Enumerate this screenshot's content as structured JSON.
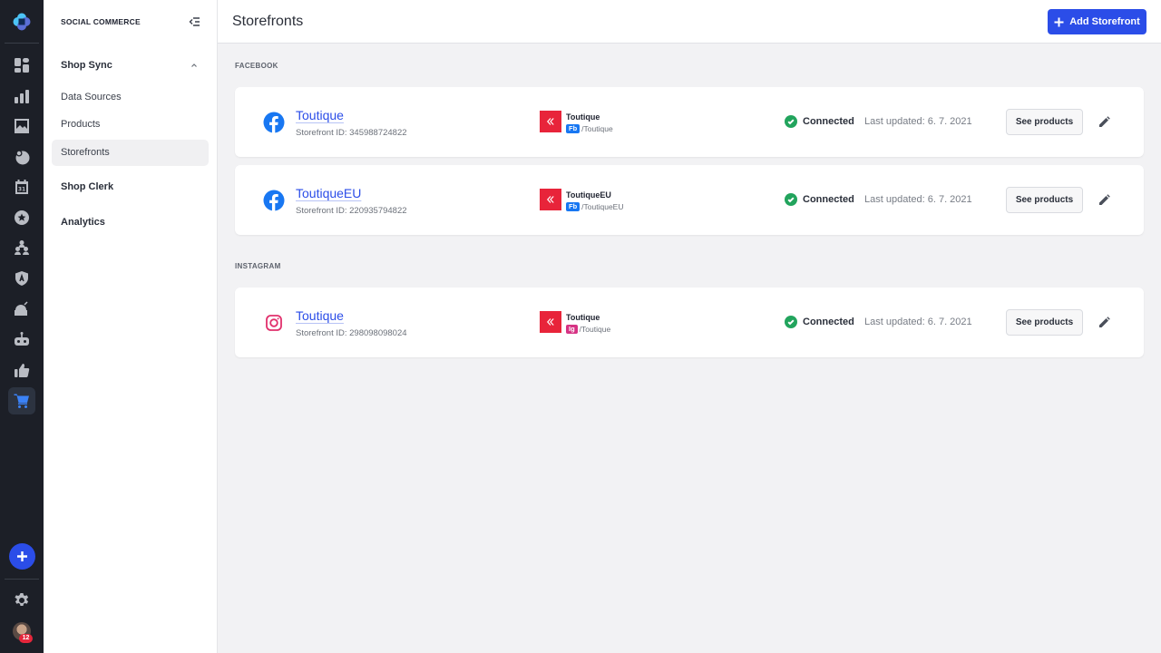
{
  "app": {
    "colors": {
      "accent": "#2b4de8",
      "success": "#22a45d",
      "rail_bg": "#1c1f27",
      "shop_logo": "#e8243a",
      "facebook": "#1877f2",
      "instagram": "#e1306c"
    }
  },
  "rail": {
    "items": [
      {
        "icon": "dashboard-icon"
      },
      {
        "icon": "bar-chart-icon"
      },
      {
        "icon": "image-icon"
      },
      {
        "icon": "audience-icon"
      },
      {
        "icon": "calendar-icon",
        "label": "31"
      },
      {
        "icon": "star-badge-icon"
      },
      {
        "icon": "hierarchy-icon"
      },
      {
        "icon": "shield-icon"
      },
      {
        "icon": "bomb-icon"
      },
      {
        "icon": "robot-icon"
      },
      {
        "icon": "thumbs-up-icon"
      },
      {
        "icon": "shopping-cart-icon",
        "active": true
      }
    ],
    "notifications_count": "12"
  },
  "nav": {
    "title": "SOCIAL COMMERCE",
    "groups": [
      {
        "label": "Shop Sync",
        "expanded": true,
        "items": [
          "Data Sources",
          "Products",
          "Storefronts"
        ],
        "active_item": "Storefronts"
      },
      {
        "label": "Shop Clerk"
      },
      {
        "label": "Analytics"
      }
    ]
  },
  "header": {
    "title": "Storefronts",
    "add_button_label": "Add Storefront"
  },
  "sections": [
    {
      "label": "FACEBOOK",
      "storefronts": [
        {
          "platform": "facebook",
          "name": "Toutique",
          "storefront_id": "Storefront ID: 345988724822",
          "shop_name": "Toutique",
          "shop_tag": "Fb",
          "shop_handle": "/Toutique",
          "status": "Connected",
          "last_updated": "Last updated: 6. 7. 2021",
          "see_products_label": "See products"
        },
        {
          "platform": "facebook",
          "name": "ToutiqueEU",
          "storefront_id": "Storefront ID: 220935794822",
          "shop_name": "ToutiqueEU",
          "shop_tag": "Fb",
          "shop_handle": "/ToutiqueEU",
          "status": "Connected",
          "last_updated": "Last updated: 6. 7. 2021",
          "see_products_label": "See products"
        }
      ]
    },
    {
      "label": "INSTAGRAM",
      "storefronts": [
        {
          "platform": "instagram",
          "name": "Toutique",
          "storefront_id": "Storefront ID: 298098098024",
          "shop_name": "Toutique",
          "shop_tag": "Ig",
          "shop_handle": "/Toutique",
          "status": "Connected",
          "last_updated": "Last updated: 6. 7. 2021",
          "see_products_label": "See products"
        }
      ]
    }
  ]
}
